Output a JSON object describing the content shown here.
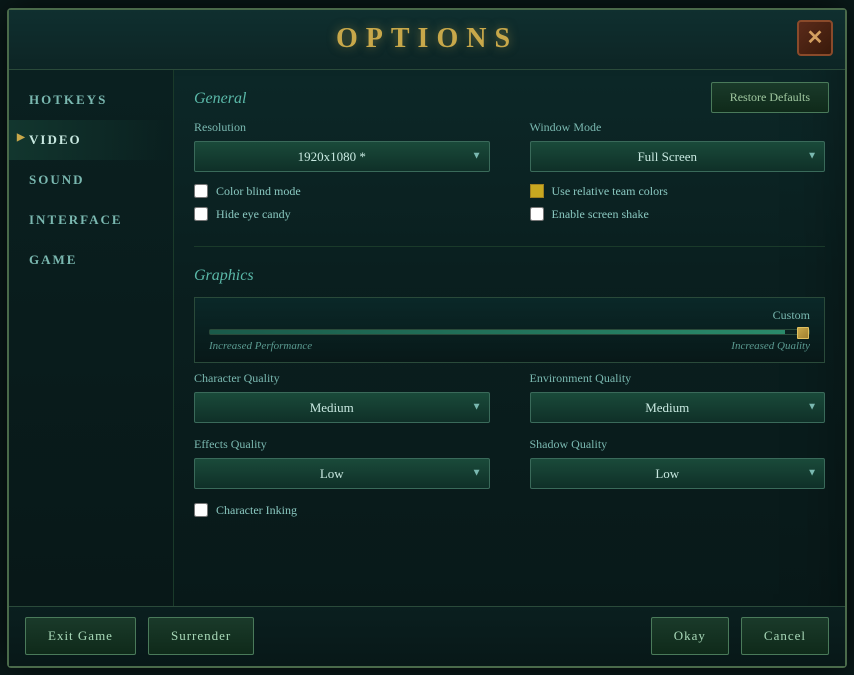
{
  "title": "OPTIONS",
  "close_btn": "✕",
  "sidebar": {
    "items": [
      {
        "id": "hotkeys",
        "label": "HOTKEYS",
        "active": false
      },
      {
        "id": "video",
        "label": "VIDEO",
        "active": true
      },
      {
        "id": "sound",
        "label": "SOUND",
        "active": false
      },
      {
        "id": "interface",
        "label": "INTERFACE",
        "active": false
      },
      {
        "id": "game",
        "label": "GAME",
        "active": false
      }
    ]
  },
  "content": {
    "restore_defaults": "Restore Defaults",
    "general_title": "General",
    "resolution_label": "Resolution",
    "resolution_value": "1920x1080 *",
    "window_mode_label": "Window Mode",
    "window_mode_value": "Full Screen",
    "checkboxes": [
      {
        "id": "color-blind",
        "label": "Color blind mode",
        "checked": false,
        "icon": false
      },
      {
        "id": "hide-eye",
        "label": "Hide eye candy",
        "checked": false,
        "icon": false
      },
      {
        "id": "relative-team",
        "label": "Use relative team colors",
        "checked": true,
        "icon": true
      },
      {
        "id": "screen-shake",
        "label": "Enable screen shake",
        "checked": false,
        "icon": false
      }
    ],
    "graphics_title": "Graphics",
    "quality_preset": "Custom",
    "slider_percent": 96,
    "perf_label": "Increased Performance",
    "quality_label": "Increased Quality",
    "dropdowns": [
      {
        "id": "char-quality",
        "label": "Character Quality",
        "value": "Medium"
      },
      {
        "id": "env-quality",
        "label": "Environment Quality",
        "value": "Medium"
      },
      {
        "id": "effects-quality",
        "label": "Effects Quality",
        "value": "Low"
      },
      {
        "id": "shadow-quality",
        "label": "Shadow Quality",
        "value": "Low"
      }
    ],
    "char_inking_label": "Character Inking",
    "char_inking_checked": false
  },
  "bottom_buttons": [
    {
      "id": "exit-game",
      "label": "Exit Game"
    },
    {
      "id": "surrender",
      "label": "Surrender"
    },
    {
      "id": "okay",
      "label": "Okay"
    },
    {
      "id": "cancel",
      "label": "Cancel"
    }
  ]
}
